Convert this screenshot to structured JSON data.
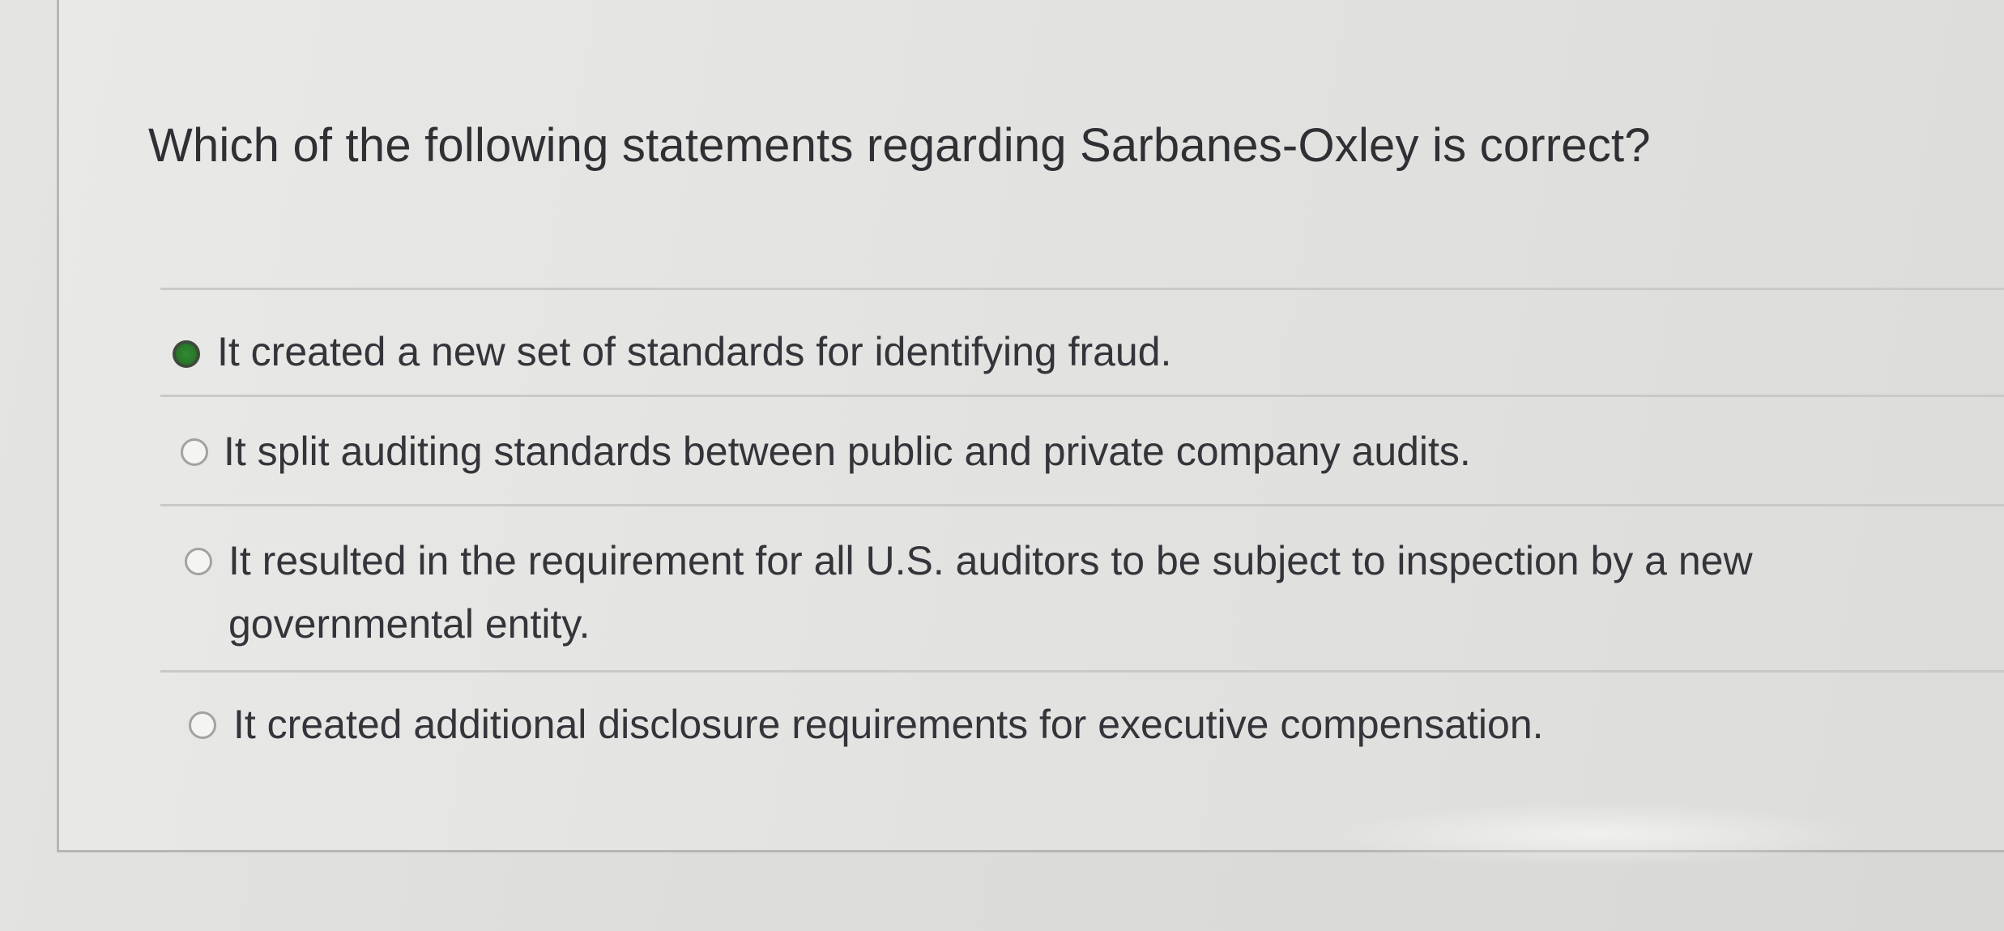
{
  "question": {
    "text": "Which of the following statements regarding Sarbanes-Oxley is correct?"
  },
  "options": [
    {
      "label": "It created a new set of standards for identifying fraud.",
      "selected": true
    },
    {
      "label": "It split auditing standards between public and private company audits.",
      "selected": false
    },
    {
      "label": "It resulted in the requirement for all U.S. auditors to be subject to inspection by a new governmental entity.",
      "selected": false
    },
    {
      "label": "It created additional disclosure requirements for executive compensation.",
      "selected": false
    }
  ],
  "colors": {
    "selected_radio": "#2f8a2f",
    "text": "#2e2f33",
    "background": "#e2e2e0"
  }
}
